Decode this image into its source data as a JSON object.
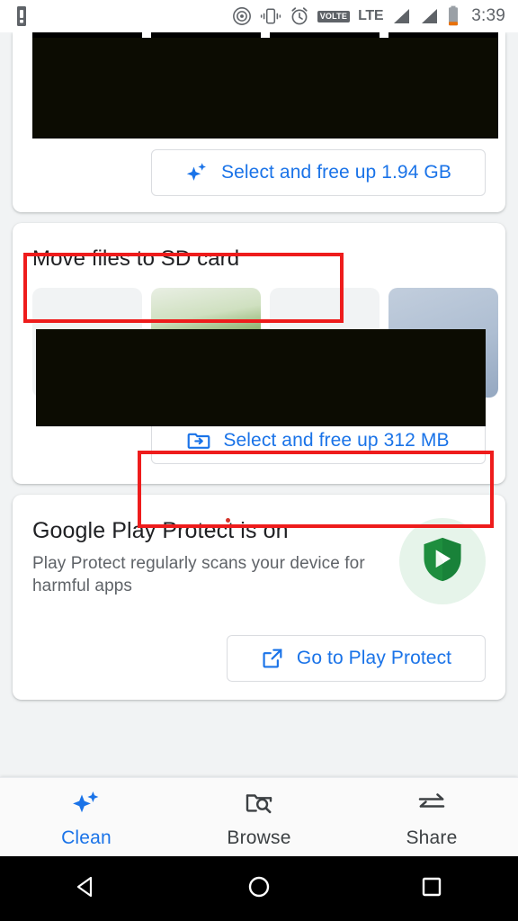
{
  "status_bar": {
    "icons": [
      "battery-alert-icon",
      "cast-icon",
      "vibrate-icon",
      "alarm-icon",
      "volte-icon",
      "signal-icon",
      "signal-icon",
      "battery-icon"
    ],
    "volte_label": "VOLTE",
    "network_label": "LTE",
    "time": "3:39"
  },
  "cards": {
    "junk": {
      "button_label": "Select and free up 1.94 GB",
      "button_icon": "sparkle-icon",
      "thumbnails": [
        "video-thumb-dark",
        "video-thumb-dark",
        "video-thumb-dark",
        "video-thumb-dark"
      ]
    },
    "sd_card": {
      "title": "Move files to SD card",
      "button_label": "Select and free up 312 MB",
      "button_icon": "folder-move-icon",
      "thumbnails": [
        "photo-thumb-grey",
        "photo-thumb-green",
        "photo-thumb-grey",
        "photo-thumb-blue"
      ]
    },
    "play_protect": {
      "title": "Google Play Protect is on",
      "subtitle": "Play Protect regularly scans your device for harmful apps",
      "badge_icon": "play-protect-shield-icon",
      "button_label": "Go to Play Protect",
      "button_icon": "open-in-new-icon"
    }
  },
  "tabbar": {
    "items": [
      {
        "label": "Clean",
        "icon": "sparkle-icon",
        "active": true
      },
      {
        "label": "Browse",
        "icon": "folder-search-icon",
        "active": false
      },
      {
        "label": "Share",
        "icon": "swap-arrows-icon",
        "active": false
      }
    ]
  },
  "navbar": {
    "items": [
      {
        "name": "back",
        "icon": "triangle-back-icon"
      },
      {
        "name": "home",
        "icon": "circle-home-icon"
      },
      {
        "name": "recents",
        "icon": "square-recents-icon"
      }
    ]
  },
  "colors": {
    "accent_blue": "#1a73e8",
    "annotation_red": "#ee1c1c",
    "play_protect_green": "#1e8e3e",
    "background": "#f1f3f4"
  }
}
